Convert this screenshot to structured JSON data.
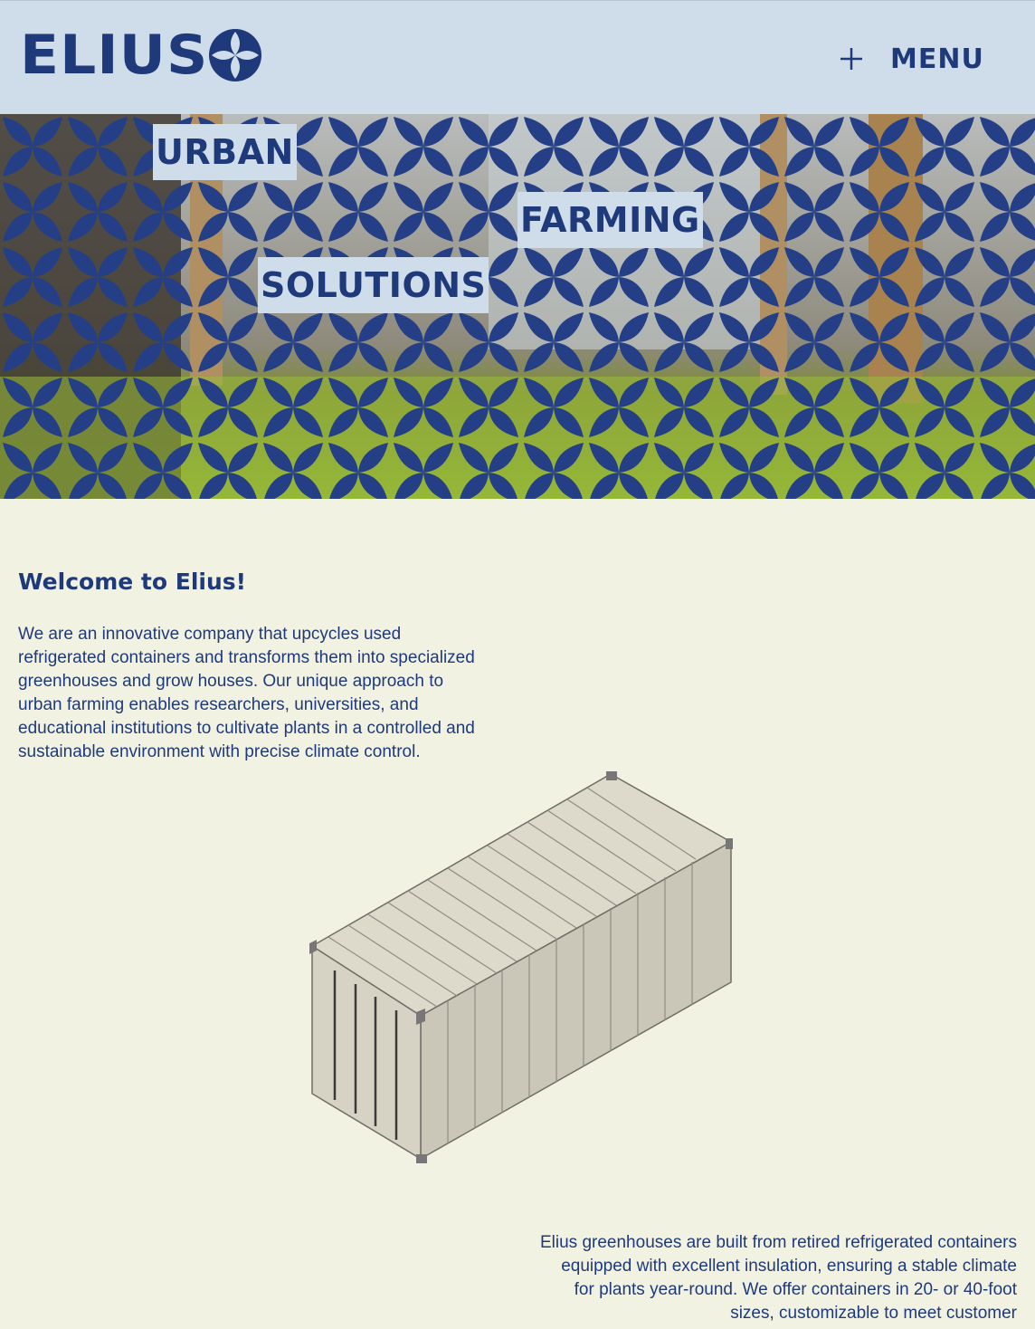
{
  "header": {
    "logo_text": "ELIUS",
    "logo_icon": "petal-cross-icon",
    "menu_icon": "plus-icon",
    "menu_label": "MENU"
  },
  "hero": {
    "words": [
      "URBAN",
      "FARMING",
      "SOLUTIONS"
    ],
    "pattern_icon": "petal-pattern"
  },
  "welcome": {
    "title": "Welcome to Elius!",
    "body": "We are an innovative company that upcycles used refrigerated containers and transforms them into specialized greenhouses and grow houses. Our unique approach to urban farming enables researchers, universities, and educational institutions to cultivate plants in a controlled and sustainable environment with precise climate control."
  },
  "container_image": {
    "icon": "shipping-container-illustration"
  },
  "second_section": {
    "body": "Elius greenhouses are built from retired refrigerated containers equipped with excellent insulation, ensuring a stable climate for plants year-round. We offer containers in 20- or 40-foot sizes, customizable to meet customer"
  },
  "colors": {
    "brand_blue": "#1f3a7a",
    "header_bg": "#cfdcea",
    "page_bg": "#f2f2e2",
    "pattern_blue": "#243f86"
  }
}
